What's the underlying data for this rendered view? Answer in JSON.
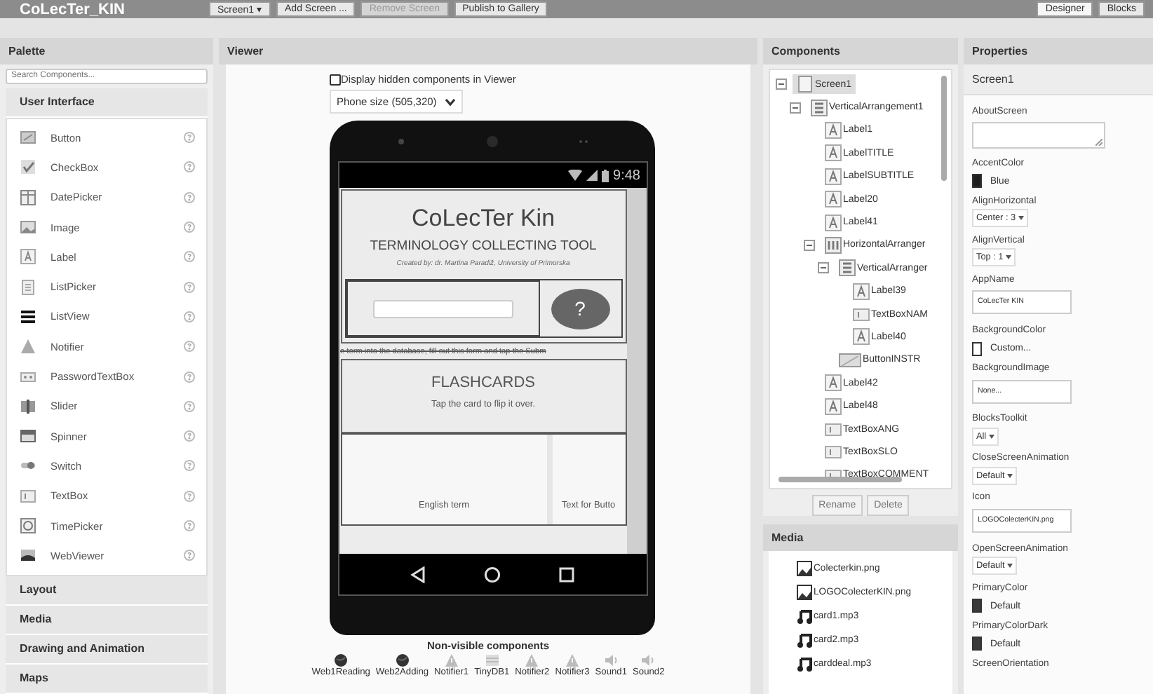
{
  "app_bar": {
    "project": "CoLecTer_KIN",
    "buttons": [
      {
        "label": "Screen1 ▾",
        "disabled": false
      },
      {
        "label": "Add Screen ...",
        "disabled": false
      },
      {
        "label": "Remove Screen",
        "disabled": true
      },
      {
        "label": "Publish to Gallery",
        "disabled": false
      }
    ],
    "views": [
      {
        "label": "Designer",
        "selected": true
      },
      {
        "label": "Blocks",
        "selected": false
      }
    ]
  },
  "palette": {
    "title": "Palette",
    "search_placeholder": "Search Components...",
    "categories": [
      {
        "label": "User Interface",
        "items": [
          {
            "label": "Button",
            "kind": "button"
          },
          {
            "label": "CheckBox",
            "kind": "checkbox"
          },
          {
            "label": "DatePicker",
            "kind": "datepicker"
          },
          {
            "label": "Image",
            "kind": "image"
          },
          {
            "label": "Label",
            "kind": "label"
          },
          {
            "label": "ListPicker",
            "kind": "listpicker"
          },
          {
            "label": "ListView",
            "kind": "listview"
          },
          {
            "label": "Notifier",
            "kind": "notifier"
          },
          {
            "label": "PasswordTextBox",
            "kind": "password"
          },
          {
            "label": "Slider",
            "kind": "slider"
          },
          {
            "label": "Spinner",
            "kind": "spinner"
          },
          {
            "label": "Switch",
            "kind": "switch"
          },
          {
            "label": "TextBox",
            "kind": "textbox"
          },
          {
            "label": "TimePicker",
            "kind": "timepicker"
          },
          {
            "label": "WebViewer",
            "kind": "webviewer"
          }
        ]
      },
      {
        "label": "Layout"
      },
      {
        "label": "Media"
      },
      {
        "label": "Drawing and Animation"
      },
      {
        "label": "Maps"
      }
    ]
  },
  "viewer": {
    "title": "Viewer",
    "hidden_toggle": {
      "label": "Display hidden components in Viewer",
      "checked": false
    },
    "size_select": "Phone size (505,320)",
    "phone": {
      "time": "9:48",
      "title": "CoLecTer Kin",
      "subtitle": "TERMINOLOGY COLLECTING TOOL",
      "credits": "Created by: dr. Martina Paradiž, University of Primorska",
      "help_button": "?",
      "marquee": "e term into the database, fill out this form and tap the Subm",
      "flashcards_title": "FLASHCARDS",
      "flashcards_hint": "Tap the card to flip it over.",
      "cards": [
        "English term",
        "Text for Butto"
      ]
    },
    "nonvisible": {
      "title": "Non-visible components",
      "items": [
        {
          "label": "Web1Reading",
          "kind": "web"
        },
        {
          "label": "Web2Adding",
          "kind": "web"
        },
        {
          "label": "Notifier1",
          "kind": "notifier"
        },
        {
          "label": "TinyDB1",
          "kind": "tinydb"
        },
        {
          "label": "Notifier2",
          "kind": "notifier"
        },
        {
          "label": "Notifier3",
          "kind": "notifier"
        },
        {
          "label": "Sound1",
          "kind": "sound"
        },
        {
          "label": "Sound2",
          "kind": "sound"
        }
      ]
    }
  },
  "components": {
    "title": "Components",
    "tree": [
      {
        "label": "Screen1",
        "kind": "screen",
        "selected": true,
        "expanded": true,
        "children": [
          {
            "label": "VerticalArrangement1",
            "kind": "vertical",
            "selected": false,
            "expanded": true,
            "children": [
              {
                "label": "Label1",
                "kind": "label",
                "selected": false
              },
              {
                "label": "LabelTITLE",
                "kind": "label",
                "selected": false
              },
              {
                "label": "LabelSUBTITLE",
                "kind": "label",
                "selected": false
              },
              {
                "label": "Label20",
                "kind": "label",
                "selected": false
              },
              {
                "label": "Label41",
                "kind": "label",
                "selected": false
              },
              {
                "label": "HorizontalArranger",
                "kind": "horizontal",
                "selected": false,
                "expanded": true,
                "children": [
                  {
                    "label": "VerticalArranger",
                    "kind": "vertical",
                    "selected": false,
                    "expanded": true,
                    "children": [
                      {
                        "label": "Label39",
                        "kind": "label",
                        "selected": false
                      },
                      {
                        "label": "TextBoxNAM",
                        "kind": "textbox",
                        "selected": false
                      },
                      {
                        "label": "Label40",
                        "kind": "label",
                        "selected": false
                      }
                    ]
                  },
                  {
                    "label": "ButtonINSTR",
                    "kind": "button",
                    "selected": false
                  }
                ]
              },
              {
                "label": "Label42",
                "kind": "label",
                "selected": false
              },
              {
                "label": "Label48",
                "kind": "label",
                "selected": false
              },
              {
                "label": "TextBoxANG",
                "kind": "textbox",
                "selected": false
              },
              {
                "label": "TextBoxSLO",
                "kind": "textbox",
                "selected": false
              },
              {
                "label": "TextBoxCOMMENT",
                "kind": "textbox",
                "selected": false
              }
            ]
          }
        ]
      }
    ],
    "buttons": [
      "Rename",
      "Delete"
    ]
  },
  "media": {
    "title": "Media",
    "files": [
      {
        "name": "Colecterkin.png",
        "kind": "image"
      },
      {
        "name": "LOGOColecterKIN.png",
        "kind": "image"
      },
      {
        "name": "card1.mp3",
        "kind": "audio"
      },
      {
        "name": "card2.mp3",
        "kind": "audio"
      },
      {
        "name": "carddeal.mp3",
        "kind": "audio"
      }
    ]
  },
  "properties": {
    "title": "Properties",
    "component": "Screen1",
    "items": [
      {
        "label": "AboutScreen",
        "kind": "textarea"
      },
      {
        "label": "AccentColor",
        "kind": "color",
        "value": "Blue",
        "color": "#1e1e1e"
      },
      {
        "label": "AlignHorizontal",
        "kind": "select",
        "value": "Center : 3"
      },
      {
        "label": "AlignVertical",
        "kind": "select",
        "value": "Top : 1"
      },
      {
        "label": "AppName",
        "kind": "text",
        "value": "CoLecTer KIN"
      },
      {
        "label": "BackgroundColor",
        "kind": "color",
        "value": "Custom...",
        "color": "#ffffff"
      },
      {
        "label": "BackgroundImage",
        "kind": "text",
        "value": "None..."
      },
      {
        "label": "BlocksToolkit",
        "kind": "select",
        "value": "All"
      },
      {
        "label": "CloseScreenAnimation",
        "kind": "select",
        "value": "Default"
      },
      {
        "label": "Icon",
        "kind": "text",
        "value": "LOGOColecterKIN.png"
      },
      {
        "label": "OpenScreenAnimation",
        "kind": "select",
        "value": "Default"
      },
      {
        "label": "PrimaryColor",
        "kind": "color",
        "value": "Default",
        "color": "#3a3a3a"
      },
      {
        "label": "PrimaryColorDark",
        "kind": "color",
        "value": "Default",
        "color": "#3a3a3a"
      },
      {
        "label": "ScreenOrientation",
        "kind": "label"
      }
    ]
  }
}
